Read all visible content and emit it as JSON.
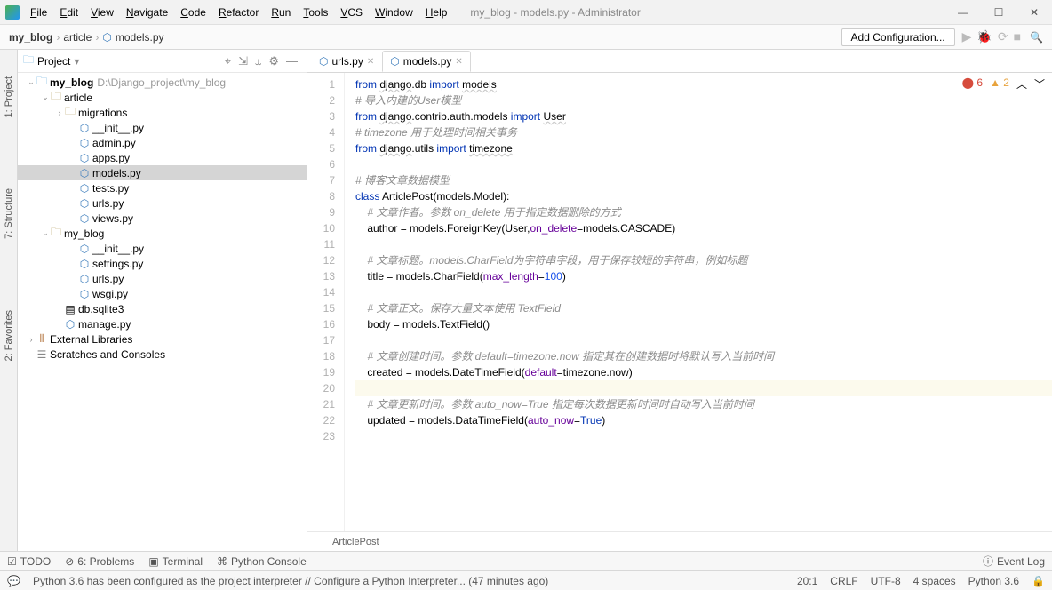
{
  "title_caption": "my_blog - models.py - Administrator",
  "menu": [
    "File",
    "Edit",
    "View",
    "Navigate",
    "Code",
    "Refactor",
    "Run",
    "Tools",
    "VCS",
    "Window",
    "Help"
  ],
  "breadcrumb": {
    "project": "my_blog",
    "module": "article",
    "file": "models.py"
  },
  "add_config": "Add Configuration...",
  "project_panel": {
    "title": "Project",
    "root": {
      "name": "my_blog",
      "path": "D:\\Django_project\\my_blog"
    },
    "tree": [
      {
        "l": 1,
        "t": "dir",
        "arrow": "v",
        "name": "article"
      },
      {
        "l": 2,
        "t": "dir",
        "arrow": ">",
        "name": "migrations"
      },
      {
        "l": 3,
        "t": "py",
        "name": "__init__.py"
      },
      {
        "l": 3,
        "t": "py",
        "name": "admin.py"
      },
      {
        "l": 3,
        "t": "py",
        "name": "apps.py"
      },
      {
        "l": 3,
        "t": "py",
        "name": "models.py",
        "sel": true
      },
      {
        "l": 3,
        "t": "py",
        "name": "tests.py"
      },
      {
        "l": 3,
        "t": "py",
        "name": "urls.py"
      },
      {
        "l": 3,
        "t": "py",
        "name": "views.py"
      },
      {
        "l": 1,
        "t": "dir",
        "arrow": "v",
        "name": "my_blog"
      },
      {
        "l": 3,
        "t": "py",
        "name": "__init__.py"
      },
      {
        "l": 3,
        "t": "py",
        "name": "settings.py"
      },
      {
        "l": 3,
        "t": "py",
        "name": "urls.py"
      },
      {
        "l": 3,
        "t": "py",
        "name": "wsgi.py"
      },
      {
        "l": 2,
        "t": "file",
        "name": "db.sqlite3"
      },
      {
        "l": 2,
        "t": "py",
        "name": "manage.py"
      }
    ],
    "ext_lib": "External Libraries",
    "scratches": "Scratches and Consoles"
  },
  "tabs": [
    {
      "name": "urls.py",
      "active": false
    },
    {
      "name": "models.py",
      "active": true
    }
  ],
  "editor": {
    "class_name": "ArticlePost",
    "problems": {
      "errors": "6",
      "warnings": "2"
    },
    "lines": [
      {
        "n": 1,
        "html": "<span class='kw'>from</span> <span class='warn'>django</span>.db <span class='kw'>import</span> <span class='warn'>models</span>"
      },
      {
        "n": 2,
        "html": "<span class='cm'># 导入内建的User模型</span>"
      },
      {
        "n": 3,
        "html": "<span class='kw'>from</span> <span class='warn'>django</span>.contrib.auth.models <span class='kw'>import</span> <span class='warn'>User</span>"
      },
      {
        "n": 4,
        "html": "<span class='cm'># timezone 用于处理时间相关事务</span>"
      },
      {
        "n": 5,
        "html": "<span class='kw'>from</span> <span class='warn'>django</span>.utils <span class='kw'>import</span> <span class='warn'>timezone</span>"
      },
      {
        "n": 6,
        "html": ""
      },
      {
        "n": 7,
        "html": "<span class='cm'># 博客文章数据模型</span>"
      },
      {
        "n": 8,
        "html": "<span class='kw'>class</span> ArticlePost(models.Model):"
      },
      {
        "n": 9,
        "html": "    <span class='cm'># 文章作者。参数 on_delete 用于指定数据删除的方式</span>"
      },
      {
        "n": 10,
        "html": "    author = models.ForeignKey(User,<span class='param'>on_delete</span>=models.CASCADE)"
      },
      {
        "n": 11,
        "html": ""
      },
      {
        "n": 12,
        "html": "    <span class='cm'># 文章标题。models.CharField为字符串字段，用于保存较短的字符串，例如标题</span>"
      },
      {
        "n": 13,
        "html": "    title = models.CharField(<span class='param'>max_length</span>=<span class='num'>100</span>)"
      },
      {
        "n": 14,
        "html": ""
      },
      {
        "n": 15,
        "html": "    <span class='cm'># 文章正文。保存大量文本使用 TextField</span>"
      },
      {
        "n": 16,
        "html": "    body = models.TextField()"
      },
      {
        "n": 17,
        "html": ""
      },
      {
        "n": 18,
        "html": "    <span class='cm'># 文章创建时间。参数 default=timezone.now 指定其在创建数据时将默认写入当前时间</span>"
      },
      {
        "n": 19,
        "html": "    created = models.DateTimeField(<span class='param'>default</span>=timezone.now)"
      },
      {
        "n": 20,
        "html": "",
        "cursor": true
      },
      {
        "n": 21,
        "html": "    <span class='cm'># 文章更新时间。参数 auto_now=True 指定每次数据更新时间时自动写入当前时间</span>"
      },
      {
        "n": 22,
        "html": "    updated = models.DataTimeField(<span class='param'>auto_now</span>=<span class='kw'>True</span>)"
      },
      {
        "n": 23,
        "html": ""
      }
    ]
  },
  "left_tabs": [
    "1: Project",
    "7: Structure",
    "2: Favorites"
  ],
  "bottom_tools": {
    "todo": "TODO",
    "problems": "6: Problems",
    "terminal": "Terminal",
    "console": "Python Console",
    "eventlog": "Event Log"
  },
  "status": {
    "msg": "Python 3.6 has been configured as the project interpreter // Configure a Python Interpreter... (47 minutes ago)",
    "pos": "20:1",
    "le": "CRLF",
    "enc": "UTF-8",
    "indent": "4 spaces",
    "py": "Python 3.6"
  }
}
